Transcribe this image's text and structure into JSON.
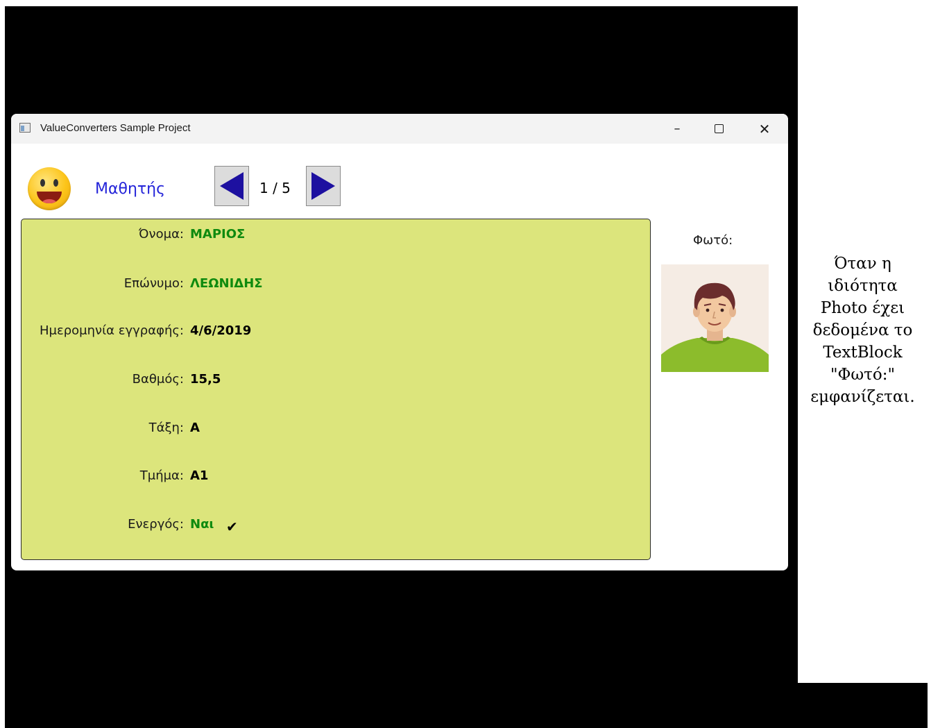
{
  "window": {
    "title": "ValueConverters Sample Project",
    "controls": {
      "minimize": "–",
      "maximize": "□",
      "close": "✕"
    }
  },
  "header": {
    "student_label": "Μαθητής",
    "page_counter": "1 / 5"
  },
  "details": [
    {
      "label": "Όνομα:",
      "value": "ΜΑΡΙΟΣ",
      "color": "#0f8a0f"
    },
    {
      "label": "Επώνυμο:",
      "value": "ΛΕΩΝΙΔΗΣ",
      "color": "#0f8a0f"
    },
    {
      "label": "Ημερομηνία εγγραφής:",
      "value": "4/6/2019",
      "color": "#000000"
    },
    {
      "label": "Βαθμός:",
      "value": "15,5",
      "color": "#000000"
    },
    {
      "label": "Τάξη:",
      "value": "A",
      "color": "#000000"
    },
    {
      "label": "Τμήμα:",
      "value": "A1",
      "color": "#000000"
    },
    {
      "label": "Ενεργός:",
      "value": "Ναι",
      "color": "#0f8a0f",
      "check": "✔"
    }
  ],
  "photo": {
    "label": "Φωτό:"
  },
  "note": {
    "lines": [
      "Όταν η",
      "ιδιότητα",
      "Photo έχει",
      "δεδομένα το",
      "TextBlock",
      "\"Φωτό:\"",
      "εμφανίζεται."
    ]
  },
  "colors": {
    "panel_bg": "#dce57c",
    "accent_blue": "#2323d9",
    "nav_arrow": "#1d10a0",
    "value_green": "#0f8a0f"
  }
}
